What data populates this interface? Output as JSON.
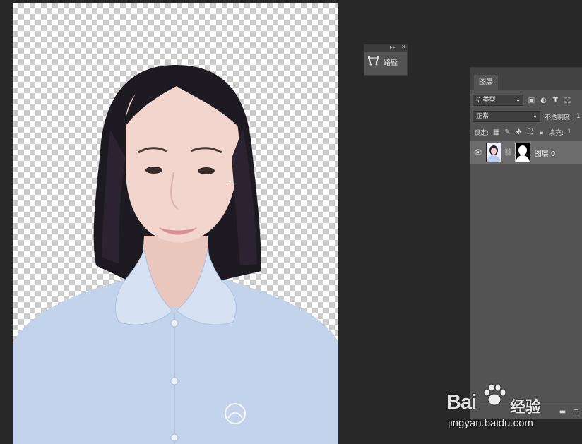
{
  "paths_panel": {
    "label": "路径",
    "collapse_glyph": "▸▸",
    "close_glyph": "✕"
  },
  "layers_panel": {
    "tab": "图层",
    "filter_kind": "类型",
    "blend_mode": "正常",
    "opacity_label": "不透明度:",
    "opacity_value": "1",
    "lock_label": "锁定:",
    "fill_label": "填充:",
    "fill_value": "1",
    "layer_name": "图层 0"
  },
  "watermark": {
    "brand": "Bai",
    "brand_cn": "经验",
    "url": "jingyan.baidu.com"
  },
  "colors": {
    "workspace": "#282828",
    "panel": "#535353",
    "selected_layer": "#6c6c6c",
    "shirt": "#c3d3ec",
    "hair": "#1d1a22"
  },
  "icons": [
    "path-icon",
    "search-icon",
    "image-filter-icon",
    "adjustment-filter-icon",
    "type-filter-icon",
    "shape-filter-icon",
    "eye-icon",
    "link-icon",
    "lock-icon",
    "folder-icon",
    "new-layer-icon"
  ]
}
